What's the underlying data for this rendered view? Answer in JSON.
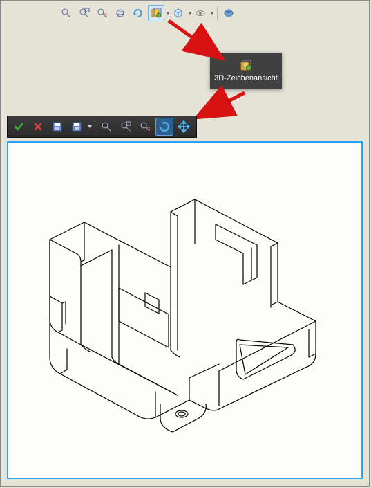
{
  "toolbar_top": {
    "buttons": [
      {
        "name": "zoom-fit-icon"
      },
      {
        "name": "zoom-window-icon"
      },
      {
        "name": "zoom-area-icon"
      },
      {
        "name": "orbit-icon"
      },
      {
        "name": "redo-view-icon"
      },
      {
        "name": "section-icon",
        "has_dropdown": true,
        "active": true
      },
      {
        "name": "view-style-icon",
        "has_dropdown": true
      },
      {
        "name": "hide-show-icon",
        "has_dropdown": true
      },
      {
        "name": "apply-scene-icon"
      }
    ]
  },
  "tooltip": {
    "label": "3D-Zeichenansicht",
    "icon": "section-3d-icon"
  },
  "toolbar_edit": {
    "buttons": [
      {
        "name": "accept-icon"
      },
      {
        "name": "cancel-icon"
      },
      {
        "name": "save-icon"
      },
      {
        "name": "open-icon",
        "has_dropdown": true
      },
      {
        "name": "zoom-fit-icon"
      },
      {
        "name": "zoom-area-icon"
      },
      {
        "name": "zoom-to-icon"
      },
      {
        "name": "rotate-icon",
        "hl": true
      },
      {
        "name": "pan-icon"
      }
    ]
  },
  "colors": {
    "arrow": "#d81212",
    "viewport_border": "#2aa4f4",
    "bg": "#e4e3d6"
  }
}
